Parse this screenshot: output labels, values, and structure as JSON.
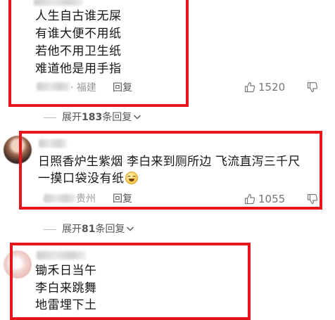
{
  "comments": [
    {
      "lines": [
        "人生自古谁无屎",
        "有谁大便不用纸",
        "若他不用卫生纸",
        "难道他是用手指"
      ],
      "location": "· 福建",
      "reply_label": "回复",
      "likes": "1520"
    },
    {
      "lines": [
        "日照香炉生紫烟  李白来到厕所边  飞流直泻三千尺",
        "一摸口袋没有纸"
      ],
      "location": "贵州",
      "reply_label": "回复",
      "likes": "1055"
    },
    {
      "lines": [
        "锄禾日当午",
        "李白来跳舞",
        "地雷埋下土"
      ]
    }
  ],
  "expand_replies": [
    {
      "prefix": "展开",
      "count": "183",
      "suffix": "条回复"
    },
    {
      "prefix": "展开",
      "count": "81",
      "suffix": "条回复"
    }
  ],
  "colors": {
    "highlight_border": "#e8141b",
    "meta_text": "#9a9a9a",
    "body_text": "#161616"
  },
  "icons": {
    "like": "thumbs-up-icon",
    "dislike": "thumbs-down-icon",
    "expand": "chevron-down-icon"
  }
}
